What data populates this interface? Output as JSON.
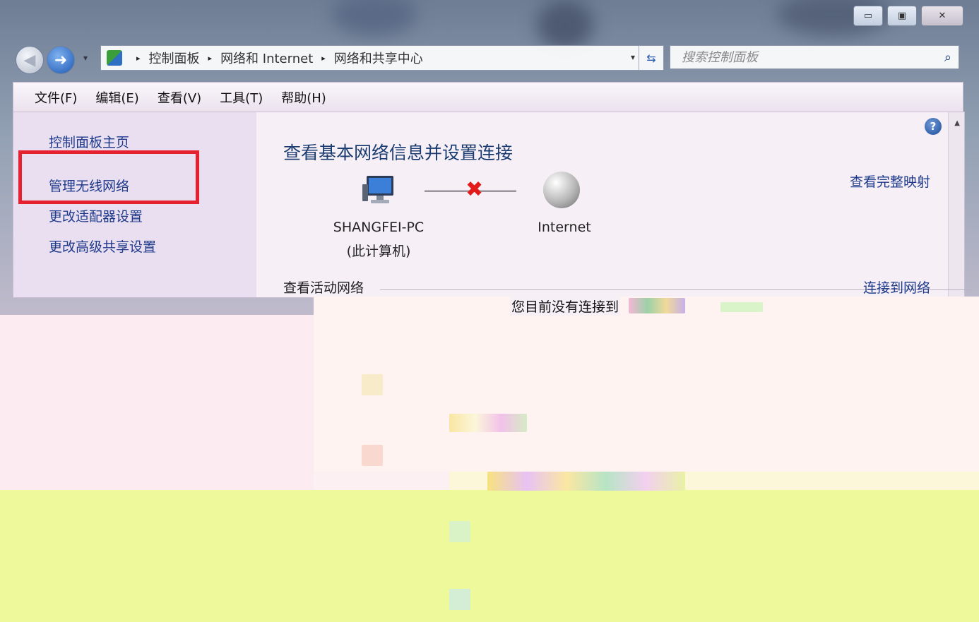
{
  "window": {
    "controls": {
      "minimize": "▭",
      "maximize": "▣",
      "close": "✕"
    }
  },
  "nav": {
    "back_icon": "back-arrow-icon",
    "forward_icon": "forward-arrow-icon",
    "history_dropdown": "▾"
  },
  "address_bar": {
    "crumbs": [
      "控制面板",
      "网络和 Internet",
      "网络和共享中心"
    ],
    "separator": "▸",
    "dropdown": "▾",
    "refresh": "⇆"
  },
  "search": {
    "placeholder": "搜索控制面板",
    "icon": "⌕"
  },
  "menubar": {
    "items": [
      "文件(F)",
      "编辑(E)",
      "查看(V)",
      "工具(T)",
      "帮助(H)"
    ]
  },
  "sidebar": {
    "items": [
      "控制面板主页",
      "管理无线网络",
      "更改适配器设置",
      "更改高级共享设置"
    ],
    "highlight_color": "#e5202f"
  },
  "main": {
    "title": "查看基本网络信息并设置连接",
    "full_map_link": "查看完整映射",
    "help": "?",
    "computer": {
      "name": "SHANGFEI-PC",
      "sub": "(此计算机)"
    },
    "internet_label": "Internet",
    "active_networks_header": "查看活动网络",
    "connect_link": "连接到网络",
    "status_text": "您目前没有连接到"
  },
  "colors": {
    "link": "#1e3a8a",
    "title": "#1a3c70",
    "error_x": "#e21a1a"
  }
}
